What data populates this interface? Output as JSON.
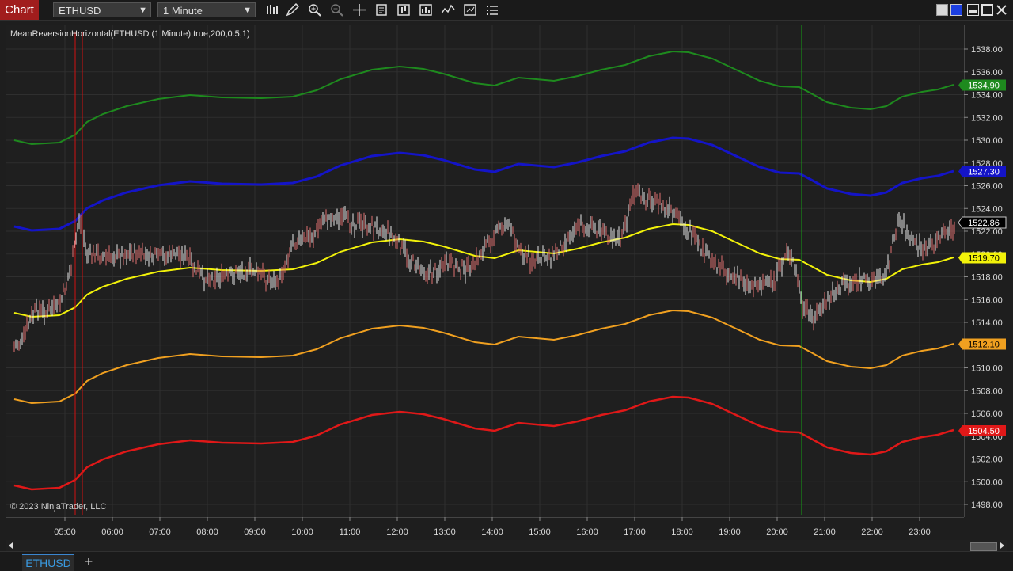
{
  "toolbar": {
    "chart_label": "Chart",
    "instrument_value": "ETHUSD",
    "interval_value": "1 Minute",
    "icons": [
      "bars-type-icon",
      "draw-pencil-icon",
      "zoom-in-icon",
      "zoom-out-icon",
      "crosshair-icon",
      "data-box-icon",
      "chart-style-icon",
      "strategies-icon",
      "indicators-icon",
      "templates-icon",
      "properties-icon"
    ]
  },
  "window": {
    "icons": [
      "gray-square-icon",
      "blue-square-icon",
      "maximize-icon",
      "close-icon"
    ]
  },
  "chart": {
    "indicator_label": "MeanReversionHorizontal(ETHUSD (1 Minute),true,200,0.5,1)",
    "copyright": "© 2023 NinjaTrader, LLC",
    "price_ticks": [
      "1538.00",
      "1536.00",
      "1534.00",
      "1532.00",
      "1530.00",
      "1528.00",
      "1526.00",
      "1524.00",
      "1522.00",
      "1520.00",
      "1518.00",
      "1516.00",
      "1514.00",
      "1512.00",
      "1510.00",
      "1508.00",
      "1506.00",
      "1504.00",
      "1502.00",
      "1500.00",
      "1498.00"
    ],
    "time_ticks": [
      "05:00",
      "06:00",
      "07:00",
      "08:00",
      "09:00",
      "10:00",
      "11:00",
      "12:00",
      "13:00",
      "14:00",
      "15:00",
      "16:00",
      "17:00",
      "18:00",
      "19:00",
      "20:00",
      "21:00",
      "22:00",
      "23:00"
    ],
    "price_markers": [
      {
        "name": "upper-band-2",
        "value": "1534.90",
        "color": "#1e8a1e"
      },
      {
        "name": "upper-band-1",
        "value": "1527.30",
        "color": "#1414c8"
      },
      {
        "name": "last-price",
        "value": "1522.86",
        "color": "#000000"
      },
      {
        "name": "mean",
        "value": "1519.70",
        "color": "#f2f20a"
      },
      {
        "name": "lower-band-1",
        "value": "1512.10",
        "color": "#f0a020"
      },
      {
        "name": "lower-band-2",
        "value": "1504.50",
        "color": "#e01818"
      }
    ],
    "colors": {
      "background": "#1f1f1f",
      "grid": "#2f2f2f",
      "upper2": "#1e8a1e",
      "upper1": "#1414c8",
      "mean": "#f2f20a",
      "lower1": "#f0a020",
      "lower2": "#e01818",
      "bar_up": "#e8e8e8",
      "bar_down": "#e07070",
      "marker_red": "#d01010",
      "marker_green": "#14a014"
    }
  },
  "tabs": {
    "active_label": "ETHUSD",
    "add_label": "+"
  }
}
